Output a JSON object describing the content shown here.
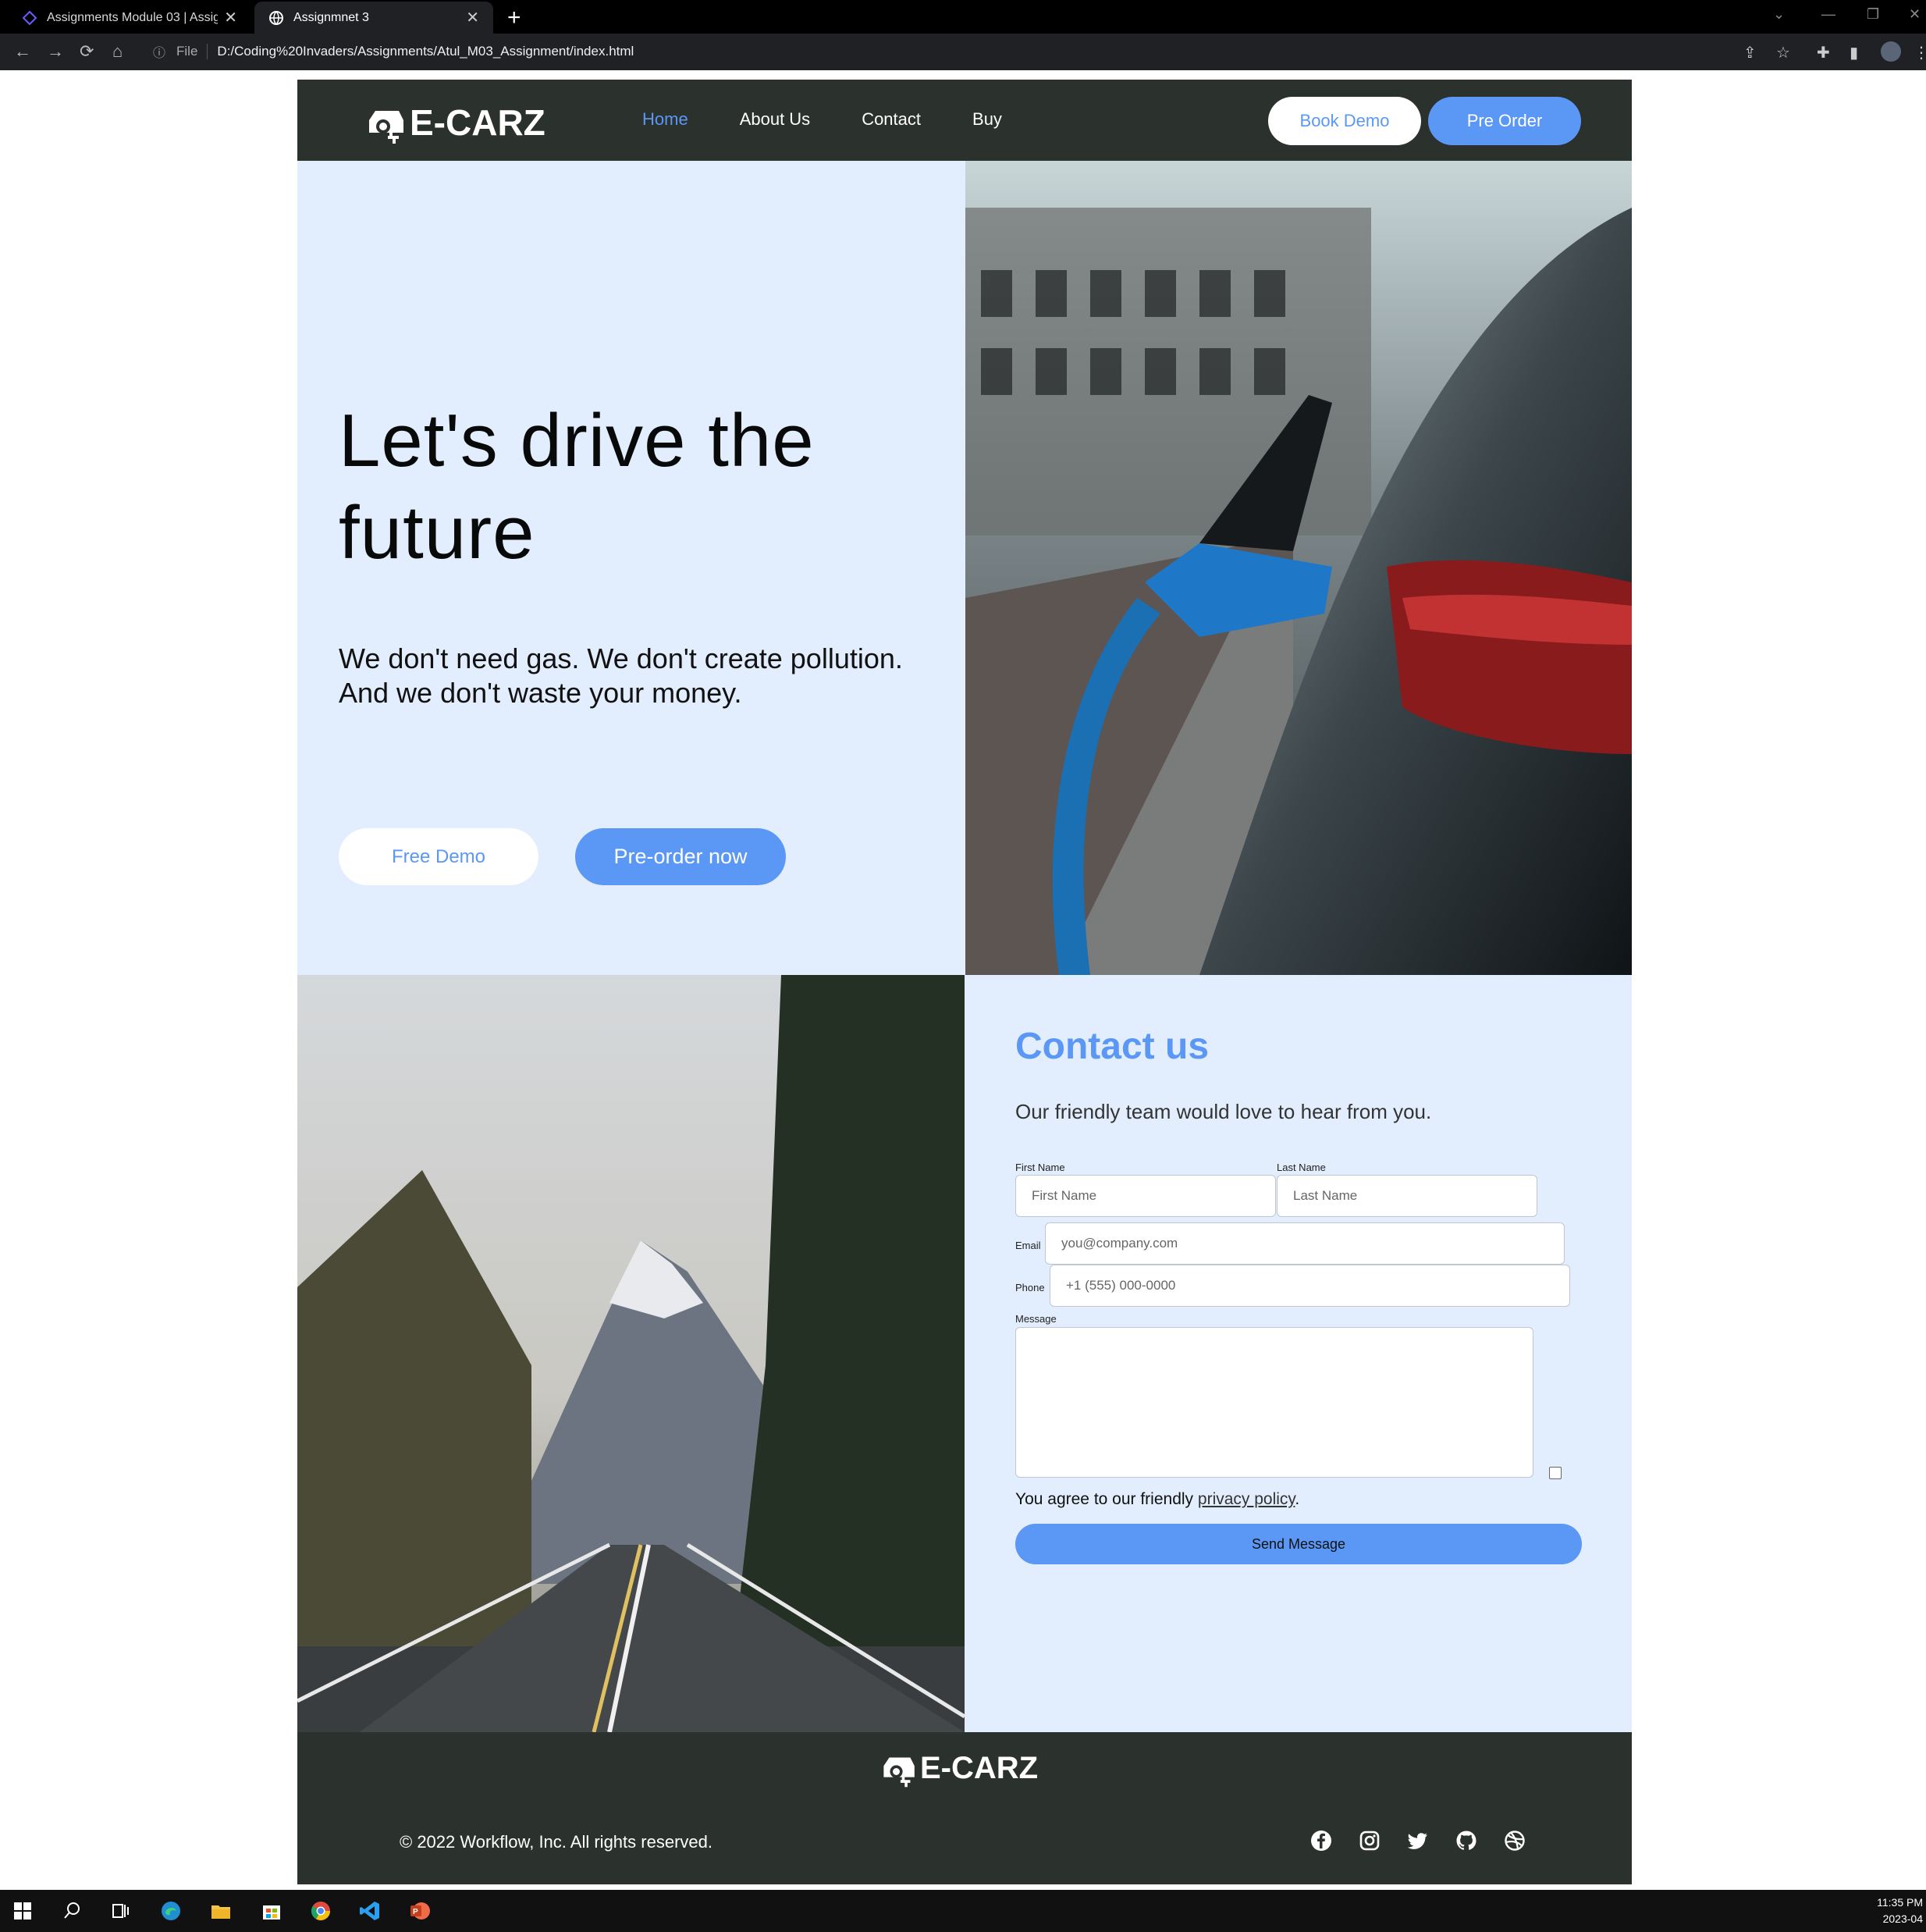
{
  "browser": {
    "tabs": [
      {
        "title": "Assignments Module 03 | Assign",
        "active": false
      },
      {
        "title": "Assignmnet 3",
        "active": true
      }
    ],
    "new_tab": "+",
    "omnibox_scheme": "File",
    "url": "D:/Coding%20Invaders/Assignments/Atul_M03_Assignment/index.html"
  },
  "navbar": {
    "logo_text": "E-CARZ",
    "links": [
      {
        "label": "Home",
        "active": true
      },
      {
        "label": "About Us",
        "active": false
      },
      {
        "label": "Contact",
        "active": false
      },
      {
        "label": "Buy",
        "active": false
      }
    ],
    "book_demo_label": "Book Demo",
    "pre_order_label": "Pre Order"
  },
  "hero": {
    "title": "Let's drive the future",
    "subtitle": "We don't need gas. We don't create pollution. And we don't waste your money.",
    "free_demo_label": "Free Demo",
    "pre_order_now_label": "Pre-order now"
  },
  "contact": {
    "title": "Contact us",
    "subtitle": "Our friendly team would love to hear from you.",
    "first_name_label": "First Name",
    "first_name_placeholder": "First Name",
    "last_name_label": "Last Name",
    "last_name_placeholder": "Last Name",
    "email_label": "Email",
    "email_placeholder": "you@company.com",
    "phone_label": "Phone",
    "phone_placeholder": "+1 (555) 000-0000",
    "message_label": "Message",
    "agree_text": "You agree to our friendly ",
    "privacy_link": "privacy policy",
    "agree_end": ".",
    "send_label": "Send Message"
  },
  "footer": {
    "logo_text": "E-CARZ",
    "copyright": "© 2022 Workflow, Inc. All rights reserved.",
    "socials": [
      "facebook-icon",
      "instagram-icon",
      "twitter-icon",
      "github-icon",
      "dribbble-icon"
    ]
  },
  "taskbar": {
    "time": "11:35 PM",
    "date": "2023-04"
  },
  "colors": {
    "accent": "#5b97f5",
    "dark": "#2b312d",
    "light_bg": "#e2edfd"
  }
}
